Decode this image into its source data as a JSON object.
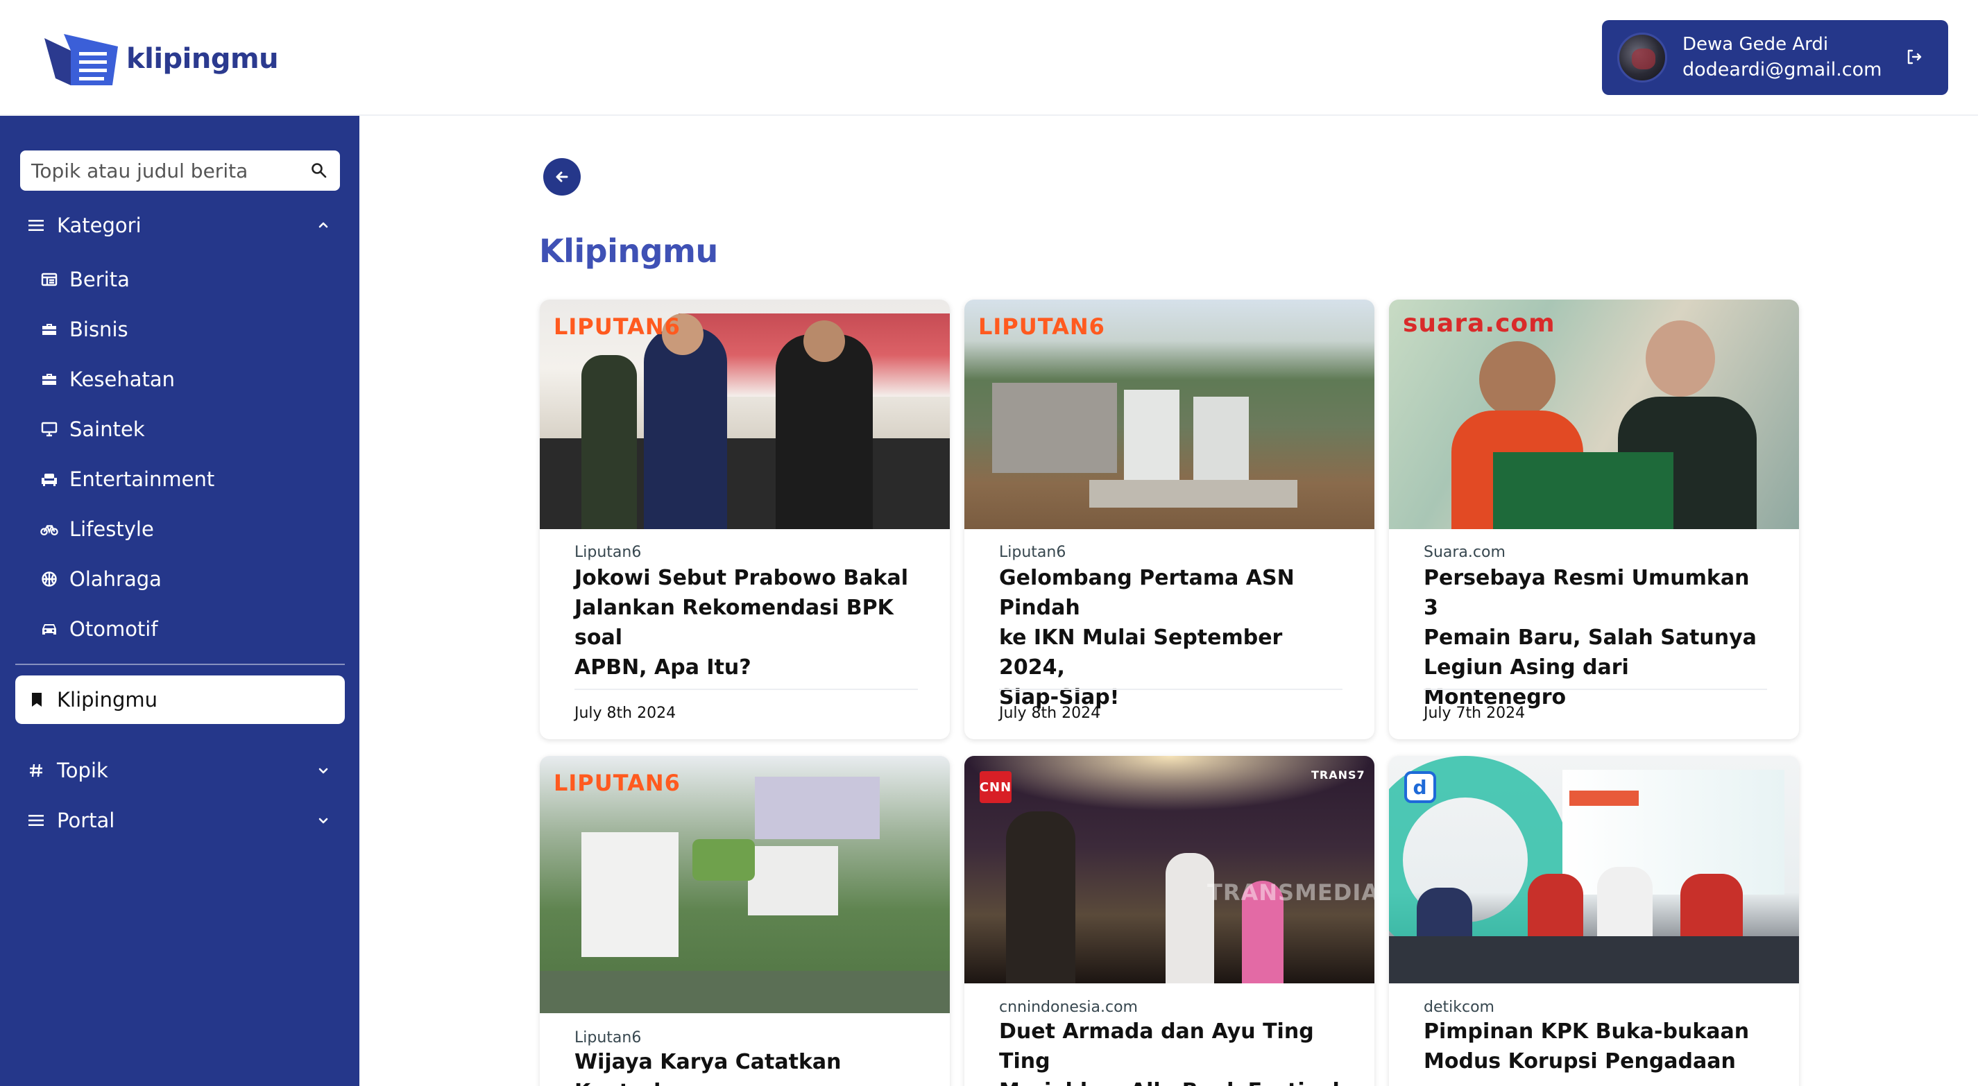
{
  "app": {
    "logo_text": "klipingmu"
  },
  "user": {
    "name": "Dewa Gede Ardi",
    "email": "dodeardi@gmail.com"
  },
  "sidebar": {
    "search_placeholder": "Topik atau judul berita",
    "kategori_label": "Kategori",
    "categories": [
      {
        "label": "Berita",
        "icon": "newspaper-icon"
      },
      {
        "label": "Bisnis",
        "icon": "briefcase-icon"
      },
      {
        "label": "Kesehatan",
        "icon": "medkit-icon"
      },
      {
        "label": "Saintek",
        "icon": "monitor-icon"
      },
      {
        "label": "Entertainment",
        "icon": "couch-icon"
      },
      {
        "label": "Lifestyle",
        "icon": "bicycle-icon"
      },
      {
        "label": "Olahraga",
        "icon": "ball-icon"
      },
      {
        "label": "Otomotif",
        "icon": "car-icon"
      }
    ],
    "active_label": "Klipingmu",
    "topik_label": "Topik",
    "portal_label": "Portal"
  },
  "main": {
    "title": "Klipingmu",
    "cards": [
      {
        "source": "Liputan6",
        "headline_lines": [
          "Jokowi Sebut Prabowo Bakal",
          "Jalankan Rekomendasi BPK soal",
          "APBN, Apa Itu?"
        ],
        "date": "July 8th 2024",
        "brand": "LIPUTAN6"
      },
      {
        "source": "Liputan6",
        "headline_lines": [
          "Gelombang Pertama ASN Pindah",
          "ke IKN Mulai September 2024,",
          "Siap-Siap!"
        ],
        "date": "July 8th 2024",
        "brand": "LIPUTAN6"
      },
      {
        "source": "Suara.com",
        "headline_lines": [
          "Persebaya Resmi Umumkan 3",
          "Pemain Baru, Salah Satunya",
          "Legiun Asing dari Montenegro"
        ],
        "date": "July 7th 2024",
        "brand": "suara.com"
      },
      {
        "source": "Liputan6",
        "headline_lines": [
          "Wijaya Karya Catatkan Kontrak"
        ],
        "date": "",
        "brand": "LIPUTAN6"
      },
      {
        "source": "cnnindonesia.com",
        "headline_lines": [
          "Duet Armada dan Ayu Ting Ting",
          "Meriahkan Allo Bank Festival"
        ],
        "date": "",
        "brand": "CNN",
        "watermark": "TRANSMEDIA",
        "badge": "TRANS7"
      },
      {
        "source": "detikcom",
        "headline_lines": [
          "Pimpinan KPK Buka-bukaan",
          "Modus Korupsi Pengadaan"
        ],
        "date": "",
        "brand": "d"
      }
    ]
  },
  "colors": {
    "primary": "#25378a",
    "title": "#3f51b5",
    "liputan_orange": "#ff5a1f"
  }
}
